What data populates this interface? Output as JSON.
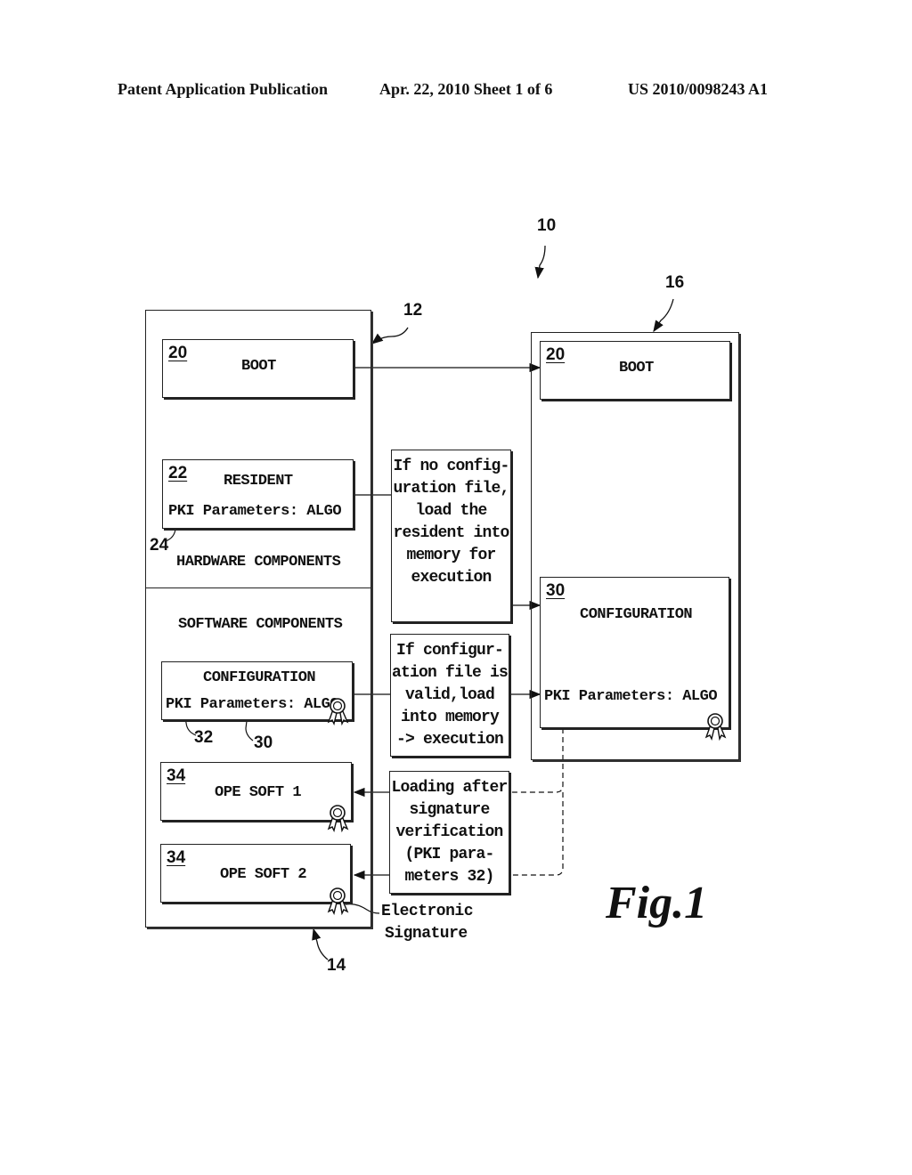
{
  "header": {
    "left": "Patent Application Publication",
    "middle": "Apr. 22, 2010  Sheet 1 of 6",
    "right": "US 2010/0098243 A1"
  },
  "reference_numerals": {
    "system": "10",
    "device": "12",
    "software_group": "14",
    "memory": "16",
    "pki_link_24": "24",
    "pki_link_32": "32",
    "config_ref_30": "30",
    "memory_pki_32": "32"
  },
  "left_device": {
    "boot": {
      "num": "20",
      "label": "BOOT"
    },
    "resident": {
      "num": "22",
      "label": "RESIDENT",
      "pki": "PKI Parameters: ALGO"
    },
    "hardware_label": "HARDWARE COMPONENTS",
    "software_label": "SOFTWARE COMPONENTS",
    "configuration": {
      "label": "CONFIGURATION",
      "pki": "PKI Parameters: ALGO"
    },
    "ope_soft_1": {
      "num": "34",
      "label": "OPE SOFT 1"
    },
    "ope_soft_2": {
      "num": "34",
      "label": "OPE SOFT 2"
    }
  },
  "right_memory": {
    "boot": {
      "num": "20",
      "label": "BOOT"
    },
    "configuration": {
      "num": "30",
      "label": "CONFIGURATION",
      "pki": "PKI Parameters: ALGO"
    }
  },
  "notes": {
    "no_config": [
      "If no config-",
      "uration file,",
      "load the",
      "resident into",
      "memory for",
      "execution"
    ],
    "valid_config": [
      "If configur-",
      "ation file is",
      "valid,load",
      "into memory",
      "-> execution"
    ],
    "loading": [
      "Loading after",
      "signature",
      "verification",
      "(PKI para-",
      "meters 32)"
    ]
  },
  "signature_label": [
    "Electronic",
    "Signature"
  ],
  "figure_label": "Fig.1",
  "icons": {
    "signature": "seal-ribbon-icon"
  }
}
